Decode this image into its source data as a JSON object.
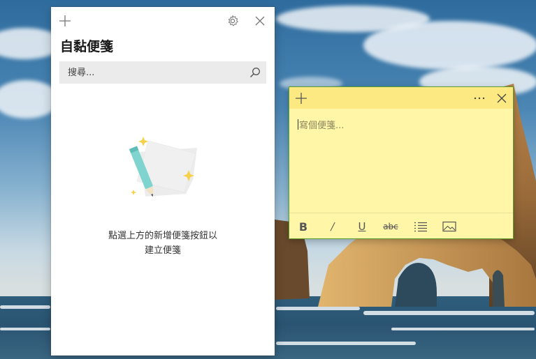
{
  "list_window": {
    "title": "自黏便箋",
    "search": {
      "placeholder": "搜尋...",
      "value": ""
    },
    "empty_message_line1": "點選上方的新增便箋按鈕以",
    "empty_message_line2": "建立便箋",
    "icons": {
      "add": "plus-icon",
      "settings": "gear-icon",
      "close": "close-icon",
      "search": "search-icon"
    }
  },
  "note_window": {
    "placeholder": "寫個便箋...",
    "toolbar": {
      "bold_label": "B",
      "italic_label": "/",
      "underline_label": "U",
      "strike_label": "abc"
    },
    "icons": {
      "add": "plus-icon",
      "more": "more-icon",
      "close": "close-icon",
      "list": "bullet-list-icon",
      "image": "image-icon"
    },
    "colors": {
      "header": "#fde982",
      "body": "#fff6a8",
      "border": "#5b9c2d"
    }
  }
}
